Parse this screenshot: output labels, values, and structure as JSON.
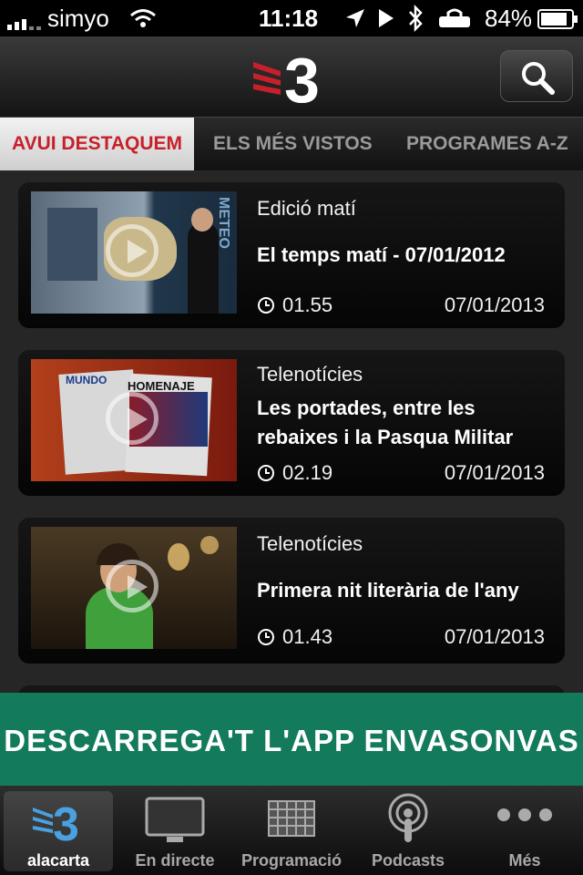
{
  "status": {
    "carrier": "simyo",
    "time": "11:18",
    "battery": "84%"
  },
  "navbar": {
    "logo": "3",
    "search_icon": "search-icon"
  },
  "tabs": [
    {
      "label": "AVUI DESTAQUEM",
      "active": true
    },
    {
      "label": "ELS MÉS VISTOS",
      "active": false
    },
    {
      "label": "PROGRAMES A-Z",
      "active": false
    }
  ],
  "videos": [
    {
      "program": "Edició matí",
      "title": "El temps matí - 07/01/2012",
      "duration": "01.55",
      "date": "07/01/2013"
    },
    {
      "program": "Telenotícies",
      "title": "Les portades, entre les rebaixes i la Pasqua Militar",
      "duration": "02.19",
      "date": "07/01/2013"
    },
    {
      "program": "Telenotícies",
      "title": "Primera nit literària de l'any",
      "duration": "01.43",
      "date": "07/01/2013"
    }
  ],
  "thumb_texts": {
    "mundo": "MUNDO",
    "homenaje": "HOMENAJE",
    "meteo": "METEO"
  },
  "banner": "DESCARREGA'T L'APP ENVASONVAS",
  "tabbar": [
    {
      "label": "alacarta",
      "icon": "tv3-logo-icon",
      "active": true
    },
    {
      "label": "En directe",
      "icon": "tv-icon",
      "active": false
    },
    {
      "label": "Programació",
      "icon": "schedule-grid-icon",
      "active": false
    },
    {
      "label": "Podcasts",
      "icon": "podcast-icon",
      "active": false
    },
    {
      "label": "Més",
      "icon": "more-dots-icon",
      "active": false
    }
  ],
  "colors": {
    "accent_red": "#c8202a",
    "banner_green": "#137a5c"
  }
}
